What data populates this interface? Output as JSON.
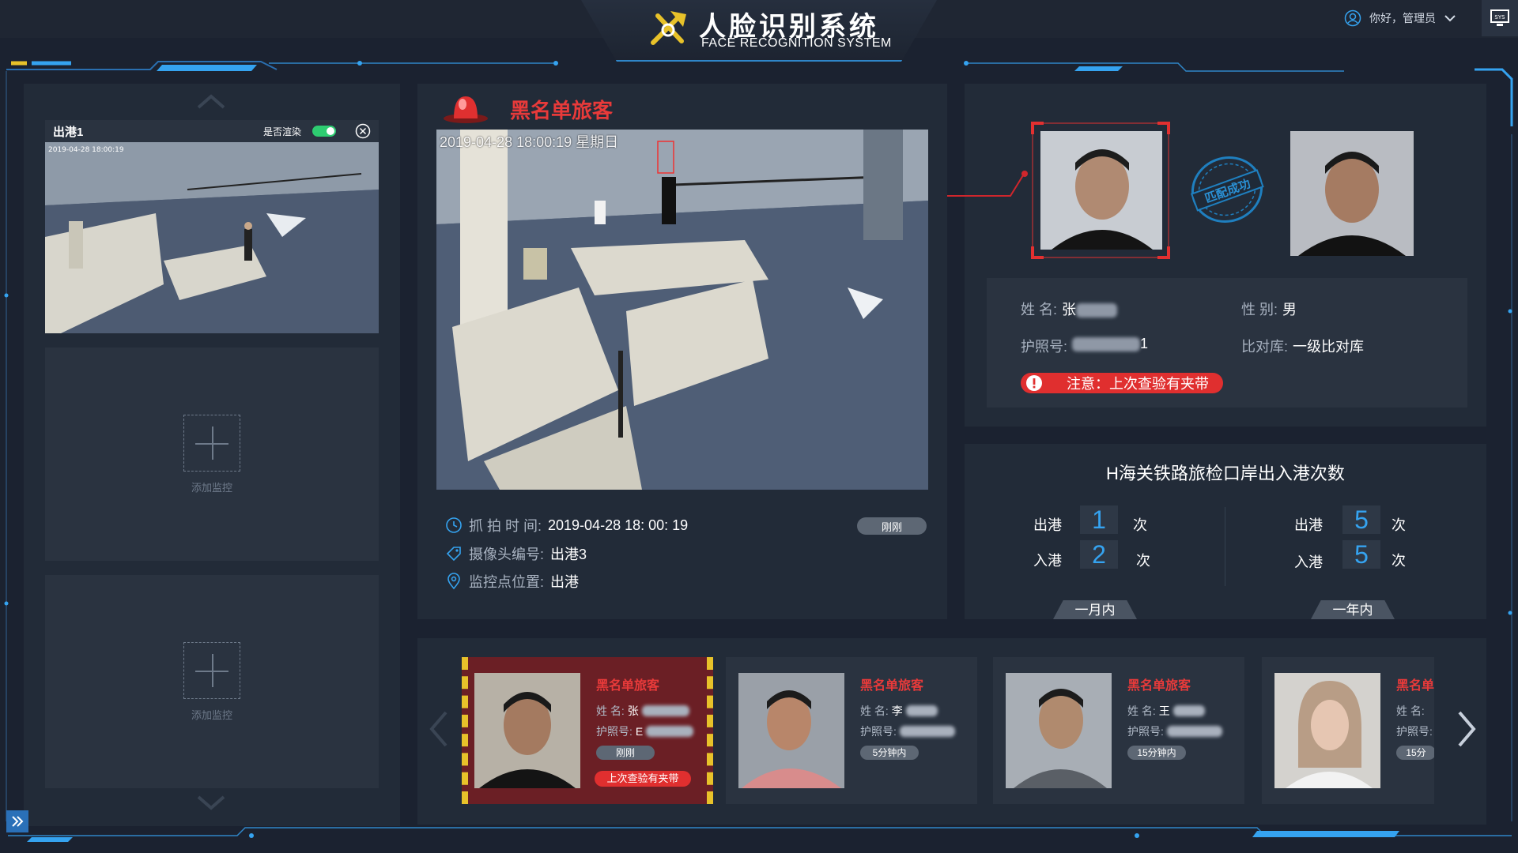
{
  "header": {
    "title": "人脸识别系统",
    "subtitle": "FACE RECOGNITION SYSTEM",
    "greeting": "你好，管理员",
    "sys_label": "SYS"
  },
  "left_panel": {
    "camera": {
      "name": "出港1",
      "render_label": "是否渲染",
      "render_enabled": true,
      "overlay": "2019-04-28 18:00:19"
    },
    "add_label": "添加监控"
  },
  "alert": {
    "title": "黑名单旅客",
    "overlay": "2019-04-28 18:00:19 星期日",
    "capture_time_label": "抓 拍 时 间:",
    "capture_time": "2019-04-28  18:  00:  19",
    "camera_no_label": "摄像头编号:",
    "camera_no": "出港3",
    "location_label": "监控点位置:",
    "location": "出港",
    "time_badge": "刚刚"
  },
  "match": {
    "stamp_text": "匹配成功",
    "name_label": "姓  名:",
    "name_value": "张",
    "gender_label": "性  别:",
    "gender_value": "男",
    "passport_label": "护照号:",
    "passport_tail": "1",
    "db_label": "比对库:",
    "db_value": "一级比对库",
    "warning": "注意：上次查验有夹带"
  },
  "stats": {
    "title": "H海关铁路旅检口岸出入港次数",
    "depart_label": "出港",
    "enter_label": "入港",
    "unit": "次",
    "month": {
      "tab": "一月内",
      "depart": "1",
      "enter": "2"
    },
    "year": {
      "tab": "一年内",
      "depart": "5",
      "enter": "5"
    }
  },
  "records": [
    {
      "title": "黑名单旅客",
      "name_label": "姓  名:",
      "name": "张",
      "passport_label": "护照号:",
      "passport": "E",
      "badge": "刚刚",
      "warning": "上次查验有夹带"
    },
    {
      "title": "黑名单旅客",
      "name_label": "姓  名:",
      "name": "李",
      "passport_label": "护照号:",
      "passport": "",
      "badge": "5分钟内"
    },
    {
      "title": "黑名单旅客",
      "name_label": "姓  名:",
      "name": "王",
      "passport_label": "护照号:",
      "passport": "",
      "badge": "15分钟内"
    },
    {
      "title": "黑名单",
      "name_label": "姓  名:",
      "name": "",
      "passport_label": "护照号:",
      "passport": "",
      "badge": "15分"
    }
  ],
  "colors": {
    "alert_red": "#e83a3a",
    "accent_blue": "#35a3f0",
    "warn_yellow": "#e8c22a",
    "panel": "#222b38"
  },
  "icons": [
    "logo-icon",
    "user-icon",
    "chevron-down-icon",
    "sys-icon",
    "chevron-up-icon",
    "close-icon",
    "plus-icon",
    "expand-icon",
    "alarm-light-icon",
    "clock-icon",
    "tag-icon",
    "location-pin-icon",
    "match-stamp-icon",
    "warning-icon",
    "arrow-left-icon",
    "arrow-right-icon"
  ]
}
